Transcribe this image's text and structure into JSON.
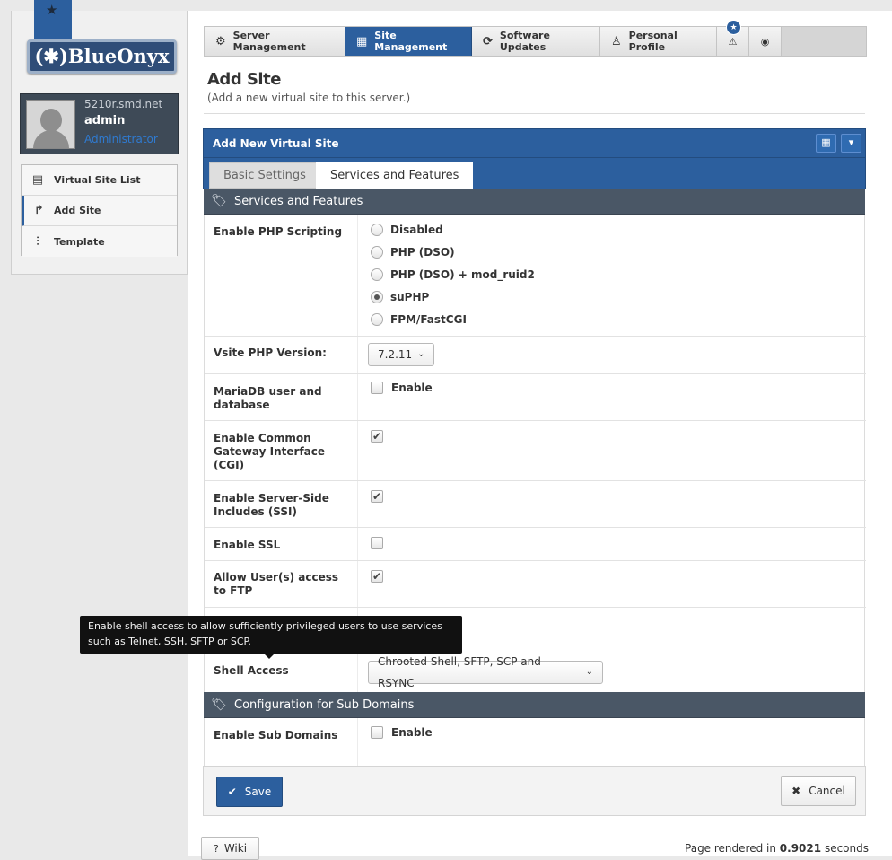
{
  "brand": {
    "logo_text": "(✱)BlueOnyx"
  },
  "user": {
    "host": "5210r.smd.net",
    "name": "admin",
    "role": "Administrator"
  },
  "sidebar": {
    "items": [
      {
        "label": "Virtual Site List",
        "icon": "list-icon",
        "active": false
      },
      {
        "label": "Add Site",
        "icon": "share-arrow-icon",
        "active": true
      },
      {
        "label": "Template",
        "icon": "sliders-icon",
        "active": false
      }
    ]
  },
  "topnav": {
    "tabs": [
      {
        "label": "Server Management",
        "icon": "gear-icon",
        "active": false
      },
      {
        "label": "Site Management",
        "icon": "grid-icon",
        "active": true
      },
      {
        "label": "Software Updates",
        "icon": "refresh-icon",
        "active": false
      },
      {
        "label": "Personal Profile",
        "icon": "user-icon",
        "active": false
      }
    ],
    "alert_icon": "warning-icon",
    "help_icon": "lifebuoy-icon",
    "badge_icon": "star-icon"
  },
  "page": {
    "title": "Add Site",
    "subtitle": "(Add a new virtual site to this server.)"
  },
  "panel": {
    "title": "Add New Virtual Site",
    "tabs": {
      "basic": "Basic Settings",
      "services": "Services and Features"
    }
  },
  "sections": {
    "services": "Services and Features",
    "subdomains": "Configuration for Sub Domains"
  },
  "form": {
    "php": {
      "label": "Enable PHP Scripting",
      "options": [
        "Disabled",
        "PHP (DSO)",
        "PHP (DSO) + mod_ruid2",
        "suPHP",
        "FPM/FastCGI"
      ],
      "selected": "suPHP"
    },
    "php_version": {
      "label": "Vsite PHP Version:",
      "value": "7.2.11"
    },
    "mariadb": {
      "label": "MariaDB user and database",
      "option": "Enable",
      "checked": false
    },
    "cgi": {
      "label": "Enable Common Gateway Interface (CGI)",
      "checked": true
    },
    "ssi": {
      "label": "Enable Server-Side Includes (SSI)",
      "checked": true
    },
    "ssl": {
      "label": "Enable SSL",
      "checked": false
    },
    "ftp": {
      "label": "Allow User(s) access to FTP",
      "checked": true
    },
    "shell": {
      "label": "Shell Access",
      "value": "Chrooted Shell, SFTP, SCP and RSYNC"
    },
    "subdomains": {
      "label": "Enable Sub Domains",
      "option": "Enable",
      "checked": false
    }
  },
  "tooltip": {
    "text": "Enable shell access to allow sufficiently privileged users to use services such as Telnet, SSH, SFTP or SCP."
  },
  "buttons": {
    "save": "Save",
    "cancel": "Cancel",
    "wiki": "Wiki"
  },
  "footer": {
    "rendered_prefix": "Page rendered in",
    "rendered_value": "0.9021",
    "rendered_suffix": "seconds"
  },
  "colors": {
    "accent": "#2c5f9e",
    "section_bar": "#4a5766"
  }
}
